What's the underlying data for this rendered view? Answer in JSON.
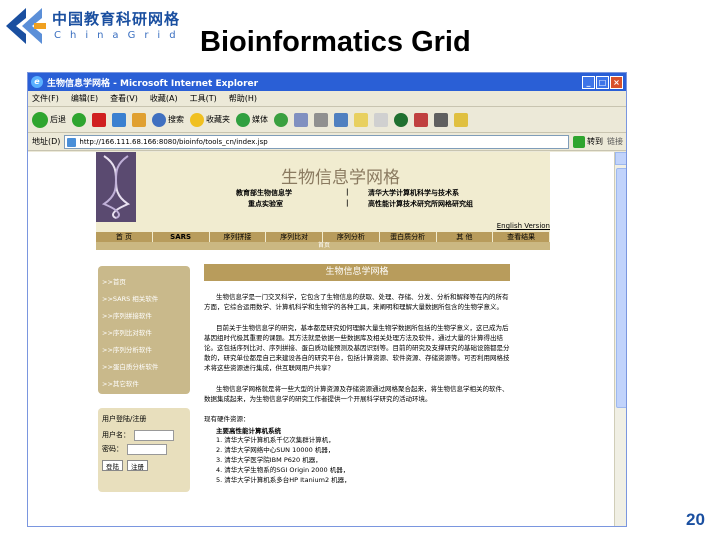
{
  "slide": {
    "logo_cn": "中国教育科研网格",
    "logo_en": "ChinaGrid",
    "title": "Bioinformatics Grid",
    "page_number": "20"
  },
  "browser": {
    "window_title": "生物信息学网格 - Microsoft Internet Explorer",
    "menu": [
      "文件(F)",
      "编辑(E)",
      "查看(V)",
      "收藏(A)",
      "工具(T)",
      "帮助(H)"
    ],
    "toolbar": {
      "back": "后退",
      "search": "搜索",
      "favorites": "收藏夹",
      "media": "媒体"
    },
    "address_label": "地址(D)",
    "address_url": "http://166.111.68.166:8080/bioinfo/tools_cn/index.jsp",
    "go_label": "转到",
    "links_label": "链接"
  },
  "site": {
    "title": "生物信息学网格",
    "org_left": [
      "教育部生物信息学",
      "重点实验室"
    ],
    "org_right": [
      "清华大学计算机科学与技术系",
      "高性能计算技术研究所网格研究组"
    ],
    "separator": "|",
    "english_link": "English Version",
    "nav": [
      "首 页",
      "SARS",
      "序列拼接",
      "序列比对",
      "序列分析",
      "蛋白质分析",
      "其 他",
      "查看结果"
    ],
    "nav_sub": "首页",
    "left_nav": [
      ">>首页",
      ">>SARS 相关软件",
      ">>序列拼接软件",
      ">>序列比对软件",
      ">>序列分析软件",
      ">>蛋白质分析软件",
      ">>其它软件"
    ],
    "login": {
      "title": "用户登陆/注册",
      "username_label": "用户名：",
      "password_label": "密码：",
      "login_button": "登陆",
      "register_button": "注册"
    },
    "content_title": "生物信息学网格",
    "paragraphs": [
      "生物信息学是一门交叉科学，它包含了生物信息的获取、处理、存储、分发、分析和解释等在内的所有方面，它综合运用数学、计算机科学和生物学的各种工具，来阐明和理解大量数据所包含的生物学意义。",
      "目前关于生物信息学的研究，基本都是研究如何理解大量生物学数据所包括的生物学意义，这已成为后基因组时代极其重要的课题。其方法就是依据一些数据库及相关处理方法及软件，通过大量的计算得出结论。这包括序列比对、序列拼接、蛋白质功能预测及基因识别等。目前的研究及支撑研究的基础设施都是分散的，研究单位都是自己来建设各自的研究平台，包括计算资源、软件资源、存储资源等。可否利用网格技术将这些资源进行集成，供互联网用户共享？",
      "生物信息学网格就是将一些大型的计算资源及存储资源通过网格聚合起来，将生物信息学相关的软件、数据集成起来，为生物信息学的研究工作者提供一个开展科学研究的活动环境。"
    ],
    "resources_label": "现有硬件资源：",
    "resources_title": "主要高性能计算机系统",
    "resources": [
      "1. 清华大学计算机系千亿次集群计算机，",
      "2. 清华大学网络中心SUN 10000 机器，",
      "3. 清华大学医学院IBM P620 机器，",
      "4. 清华大学生物系的SGI Origin 2000 机器，",
      "5. 清华大学计算机系多台HP Itanium2 机器，"
    ]
  }
}
